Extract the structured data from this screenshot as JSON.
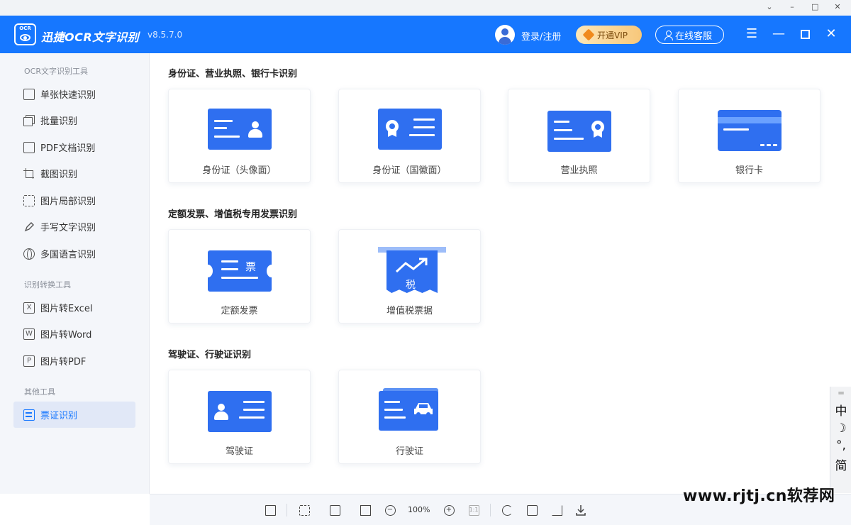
{
  "app": {
    "logo_text": "OCR",
    "title": "迅捷OCR文字识别",
    "version": "v8.5.7.0",
    "login_label": "登录/注册",
    "vip_label": "开通VIP",
    "service_label": "在线客服",
    "brand_color": "#1677ff"
  },
  "sidebar": {
    "sections": [
      {
        "title": "OCR文字识别工具"
      },
      {
        "title": "识别转换工具"
      },
      {
        "title": "其他工具"
      }
    ],
    "items": [
      {
        "label": "单张快速识别",
        "icon": "single-image-icon"
      },
      {
        "label": "批量识别",
        "icon": "batch-icon"
      },
      {
        "label": "PDF文档识别",
        "icon": "pdf-document-icon"
      },
      {
        "label": "截图识别",
        "icon": "crop-icon"
      },
      {
        "label": "图片局部识别",
        "icon": "scan-region-icon"
      },
      {
        "label": "手写文字识别",
        "icon": "pen-icon"
      },
      {
        "label": "多国语言识别",
        "icon": "globe-icon"
      },
      {
        "label": "图片转Excel",
        "icon": "excel-icon",
        "badge": "X"
      },
      {
        "label": "图片转Word",
        "icon": "word-icon",
        "badge": "W"
      },
      {
        "label": "图片转PDF",
        "icon": "pdf-icon",
        "badge": "P"
      },
      {
        "label": "票证识别",
        "icon": "ticket-icon",
        "active": true
      }
    ]
  },
  "main": {
    "sections": [
      {
        "title": "身份证、营业执照、银行卡识别",
        "cards": [
          {
            "label": "身份证（头像面）"
          },
          {
            "label": "身份证（国徽面）"
          },
          {
            "label": "营业执照"
          },
          {
            "label": "银行卡"
          }
        ]
      },
      {
        "title": "定额发票、增值税专用发票识别",
        "cards": [
          {
            "label": "定额发票",
            "art_text": "票"
          },
          {
            "label": "增值税票据",
            "art_text": "税"
          }
        ]
      },
      {
        "title": "驾驶证、行驶证识别",
        "cards": [
          {
            "label": "驾驶证"
          },
          {
            "label": "行驶证"
          }
        ]
      }
    ]
  },
  "toolbar": {
    "zoom": "100%",
    "fit_label": "1:1"
  },
  "ime": {
    "mode": "中",
    "moon": "☽",
    "punct": "°,",
    "script": "简"
  },
  "watermark": "www.rjtj.cn软荐网"
}
